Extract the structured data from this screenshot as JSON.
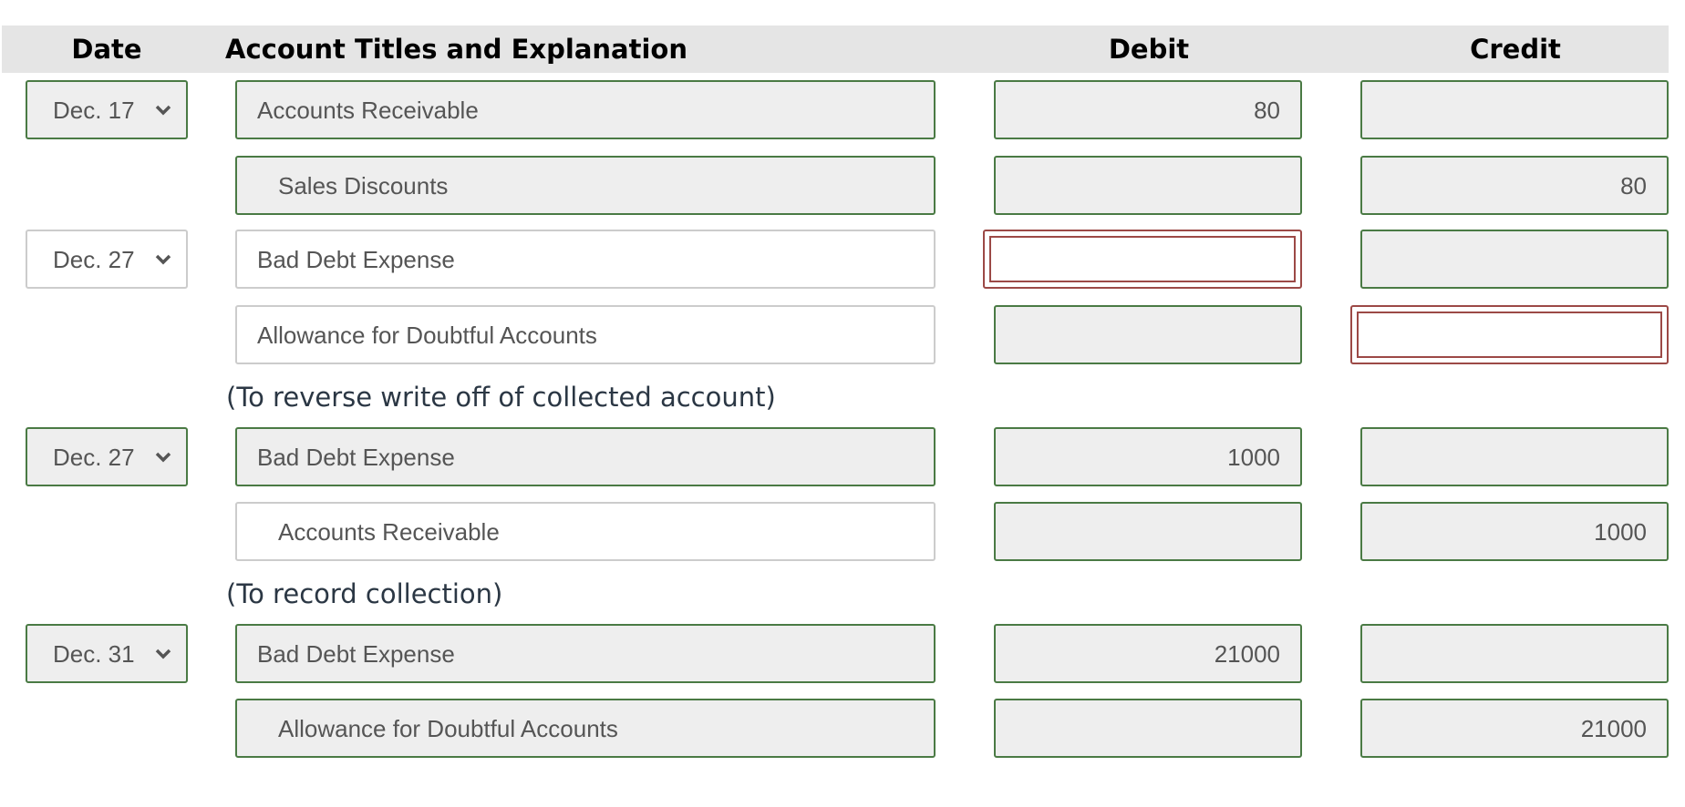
{
  "header": {
    "date": "Date",
    "account": "Account Titles and Explanation",
    "debit": "Debit",
    "credit": "Credit"
  },
  "colors": {
    "correct_border": "#4a7a44",
    "incorrect_border": "#9c4946",
    "neutral_border": "#cccccc",
    "field_bg": "#eeeeee",
    "header_bg": "#e5e5e5",
    "explanation_text": "#2b3744"
  },
  "entries": [
    {
      "date": "Dec. 17",
      "lines": [
        {
          "account": "Accounts Receivable",
          "debit": "80",
          "credit": ""
        },
        {
          "account": "Sales Discounts",
          "debit": "",
          "credit": "80"
        }
      ],
      "explanation": ""
    },
    {
      "date": "Dec. 27",
      "lines": [
        {
          "account": "Bad Debt Expense",
          "debit": "",
          "credit": ""
        },
        {
          "account": "Allowance for Doubtful Accounts",
          "debit": "",
          "credit": ""
        }
      ],
      "explanation": "(To reverse write off of collected account)"
    },
    {
      "date": "Dec. 27",
      "lines": [
        {
          "account": "Bad Debt Expense",
          "debit": "1000",
          "credit": ""
        },
        {
          "account": "Accounts Receivable",
          "debit": "",
          "credit": "1000"
        }
      ],
      "explanation": "(To record collection)"
    },
    {
      "date": "Dec. 31",
      "lines": [
        {
          "account": "Bad Debt Expense",
          "debit": "21000",
          "credit": ""
        },
        {
          "account": "Allowance for Doubtful Accounts",
          "debit": "",
          "credit": "21000"
        }
      ],
      "explanation": ""
    }
  ],
  "icons": {
    "date_dropdown": "chevron-down-icon"
  }
}
